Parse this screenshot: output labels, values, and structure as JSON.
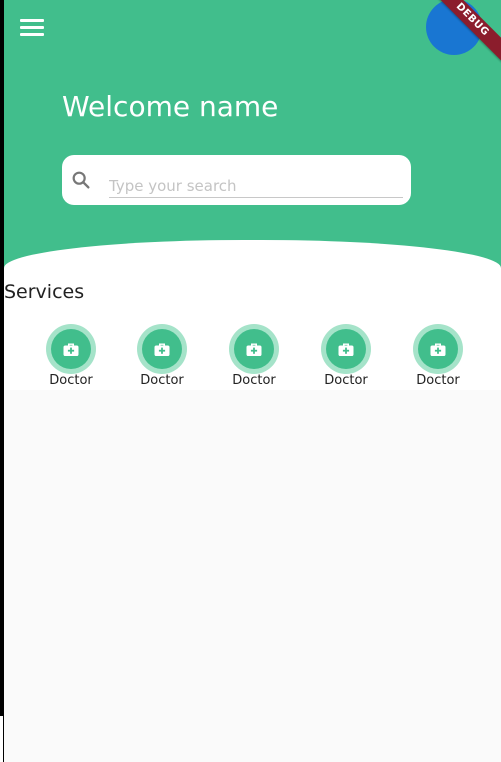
{
  "header": {
    "welcome_text": "Welcome name",
    "menu_icon": "hamburger-menu-icon",
    "avatar_color": "#1976d2",
    "brand_color": "#41be8c",
    "debug_banner": "DEBUG"
  },
  "search": {
    "placeholder": "Type your search",
    "value": "",
    "icon": "search-icon"
  },
  "services": {
    "title": "Services",
    "items": [
      {
        "label": "Doctor",
        "icon": "medical-bag-icon"
      },
      {
        "label": "Doctor",
        "icon": "medical-bag-icon"
      },
      {
        "label": "Doctor",
        "icon": "medical-bag-icon"
      },
      {
        "label": "Doctor",
        "icon": "medical-bag-icon"
      },
      {
        "label": "Doctor",
        "icon": "medical-bag-icon"
      }
    ]
  }
}
